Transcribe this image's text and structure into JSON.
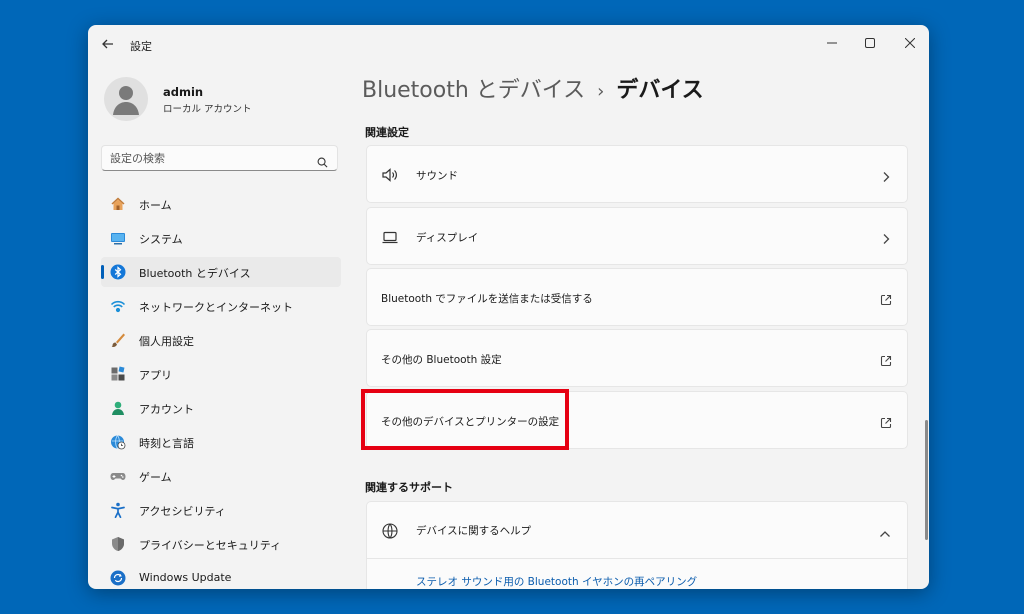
{
  "window": {
    "title": "設定"
  },
  "profile": {
    "name": "admin",
    "account_type": "ローカル アカウント"
  },
  "search": {
    "placeholder": "設定の検索"
  },
  "sidebar": {
    "items": [
      {
        "label": "ホーム",
        "icon": "home-icon"
      },
      {
        "label": "システム",
        "icon": "system-icon"
      },
      {
        "label": "Bluetooth とデバイス",
        "icon": "bluetooth-icon",
        "selected": true
      },
      {
        "label": "ネットワークとインターネット",
        "icon": "wifi-icon"
      },
      {
        "label": "個人用設定",
        "icon": "brush-icon"
      },
      {
        "label": "アプリ",
        "icon": "apps-icon"
      },
      {
        "label": "アカウント",
        "icon": "account-icon"
      },
      {
        "label": "時刻と言語",
        "icon": "globe-clock-icon"
      },
      {
        "label": "ゲーム",
        "icon": "gamepad-icon"
      },
      {
        "label": "アクセシビリティ",
        "icon": "accessibility-icon"
      },
      {
        "label": "プライバシーとセキュリティ",
        "icon": "shield-icon"
      },
      {
        "label": "Windows Update",
        "icon": "update-icon"
      }
    ]
  },
  "breadcrumb": {
    "parent": "Bluetooth とデバイス",
    "separator": "›",
    "current": "デバイス"
  },
  "related_settings": {
    "title": "関連設定",
    "items": [
      {
        "label": "サウンド",
        "icon": "speaker-icon",
        "action": "chevron-right-icon"
      },
      {
        "label": "ディスプレイ",
        "icon": "laptop-icon",
        "action": "chevron-right-icon"
      },
      {
        "label": "Bluetooth でファイルを送信または受信する",
        "action": "external-link-icon"
      },
      {
        "label": "その他の Bluetooth 設定",
        "action": "external-link-icon"
      },
      {
        "label": "その他のデバイスとプリンターの設定",
        "action": "external-link-icon"
      }
    ]
  },
  "support": {
    "title": "関連するサポート",
    "help_title": "デバイスに関するヘルプ",
    "link": "ステレオ サウンド用の Bluetooth イヤホンの再ペアリング"
  },
  "colors": {
    "desktop": "#0067b8",
    "accent": "#005fb8",
    "highlight": "#e60012",
    "link": "#0b5cad"
  }
}
